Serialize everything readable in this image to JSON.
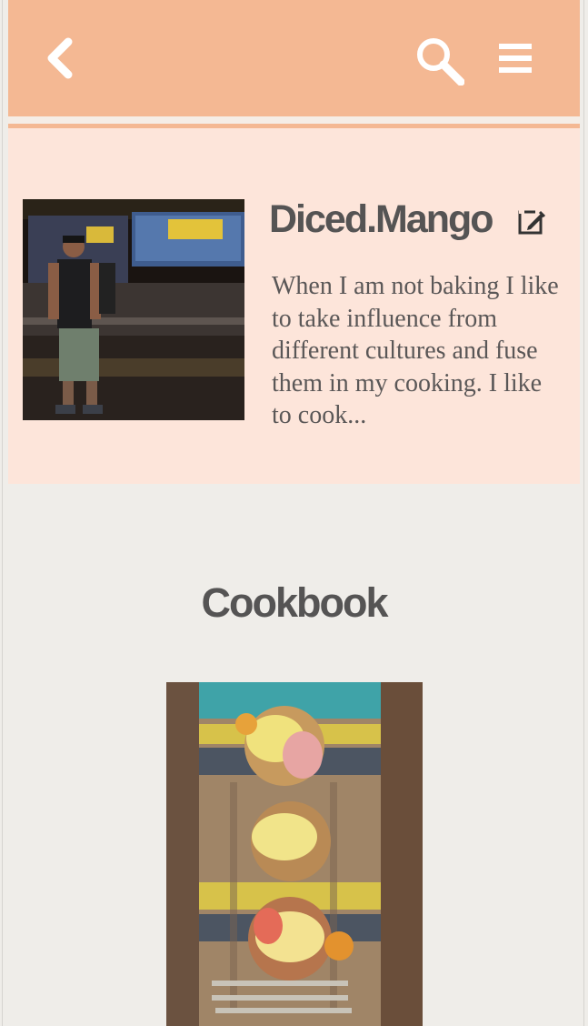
{
  "header": {
    "back_icon": "chevron-left-icon",
    "search_icon": "search-icon",
    "menu_icon": "hamburger-menu-icon",
    "bg_color": "#f4b893"
  },
  "profile": {
    "username": "Diced.Mango",
    "edit_icon": "edit-icon",
    "bio": "When I am not baking I like to take influence from different cultures and fuse them in my cooking. I like to cook...",
    "bg_color": "#fde5da"
  },
  "cookbook": {
    "title": "Cookbook"
  }
}
